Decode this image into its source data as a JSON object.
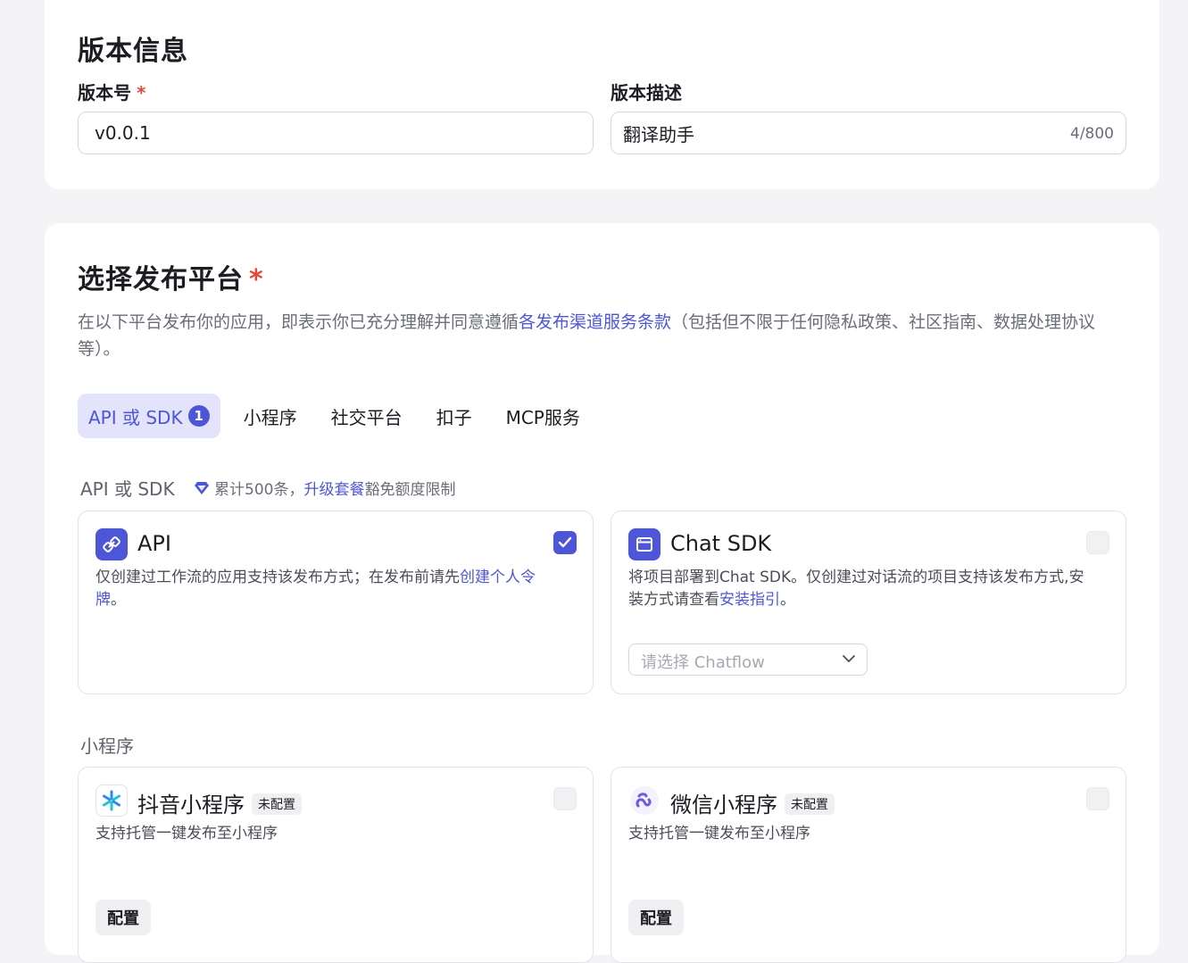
{
  "version_section": {
    "title": "版本信息",
    "version_label": "版本号",
    "required_mark": "*",
    "version_value": "v0.0.1",
    "desc_label": "版本描述",
    "desc_value": "翻译助手",
    "desc_counter": "4/800"
  },
  "platform_section": {
    "title": "选择发布平台",
    "required_mark": "*",
    "intro_prefix": "在以下平台发布你的应用，即表示你已充分理解并同意遵循",
    "intro_link": "各发布渠道服务条款",
    "intro_suffix": "（包括但不限于任何隐私政策、社区指南、数据处理协议等）。",
    "tabs": [
      {
        "label": "API 或 SDK",
        "badge": "1",
        "active": true
      },
      {
        "label": "小程序"
      },
      {
        "label": "社交平台"
      },
      {
        "label": "扣子"
      },
      {
        "label": "MCP服务"
      }
    ],
    "api_group": {
      "label": "API 或 SDK",
      "promo_prefix": "累计500条，",
      "promo_link": "升级套餐",
      "promo_suffix": " 豁免额度限制",
      "cards": [
        {
          "title": "API",
          "icon": "link-icon",
          "checked": true,
          "desc_prefix": "仅创建过工作流的应用支持该发布方式；在发布前请先",
          "desc_link": "创建个人令牌",
          "desc_suffix": "。"
        },
        {
          "title": "Chat SDK",
          "icon": "window-icon",
          "checked": false,
          "desc_prefix": "将项目部署到Chat SDK。仅创建过对话流的项目支持该发布方式,安装方式请查看",
          "desc_link": "安装指引",
          "desc_suffix": "。",
          "select_placeholder": "请选择 Chatflow"
        }
      ]
    },
    "mini_group": {
      "label": "小程序",
      "cards": [
        {
          "title": "抖音小程序",
          "tag": "未配置",
          "icon": "douyin-icon",
          "desc": "支持托管一键发布至小程序",
          "button": "配置",
          "checked": false
        },
        {
          "title": "微信小程序",
          "tag": "未配置",
          "icon": "wechat-mini-icon",
          "desc": "支持托管一键发布至小程序",
          "button": "配置",
          "checked": false
        }
      ]
    }
  },
  "colors": {
    "accent": "#4c56d6",
    "required": "#e5483a",
    "page_bg": "#f4f4f6"
  }
}
